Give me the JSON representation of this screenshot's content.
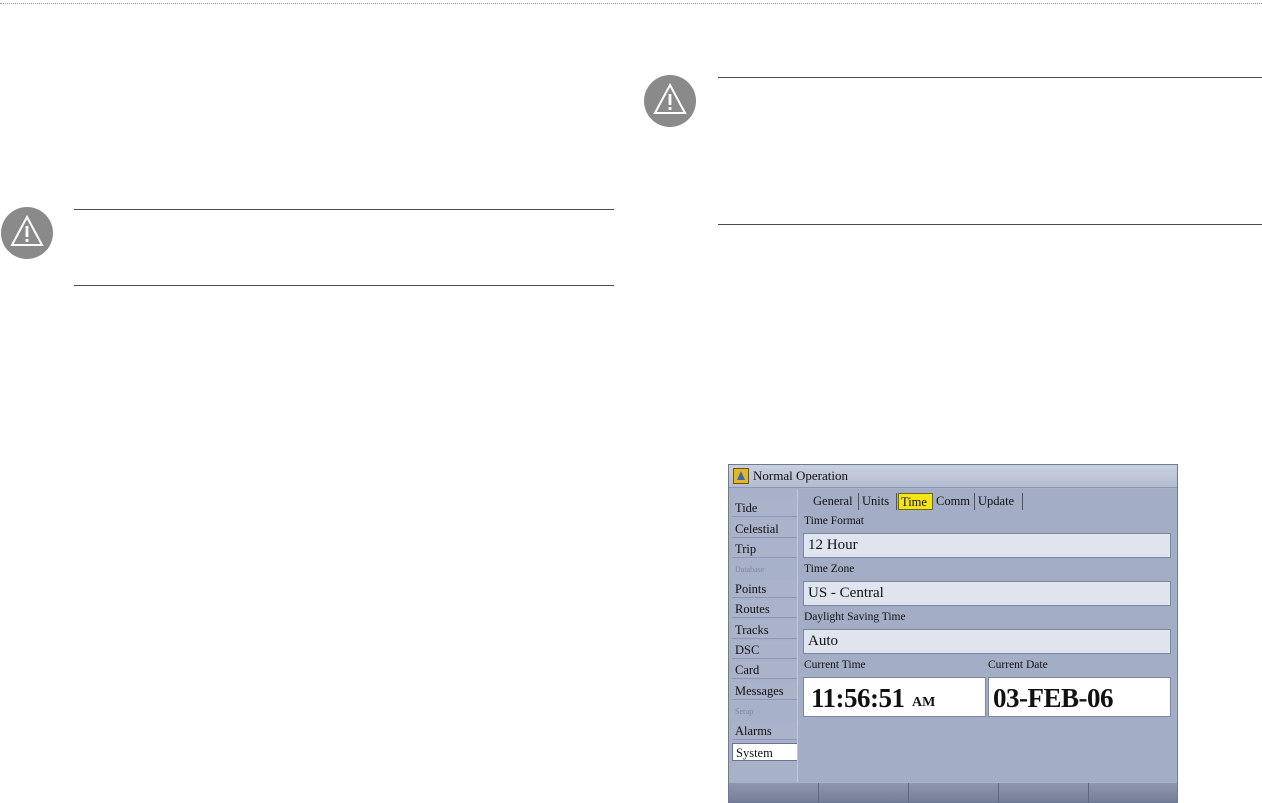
{
  "device": {
    "title": "Normal Operation",
    "sidebar_items": [
      {
        "label": "Tide",
        "type": "item"
      },
      {
        "label": "Celestial",
        "type": "item"
      },
      {
        "label": "Trip",
        "type": "item"
      },
      {
        "label": "Database",
        "type": "section"
      },
      {
        "label": "Points",
        "type": "item"
      },
      {
        "label": "Routes",
        "type": "item"
      },
      {
        "label": "Tracks",
        "type": "item"
      },
      {
        "label": "DSC",
        "type": "item"
      },
      {
        "label": "Card",
        "type": "item"
      },
      {
        "label": "Messages",
        "type": "item"
      },
      {
        "label": "Setup",
        "type": "section"
      },
      {
        "label": "Alarms",
        "type": "item"
      },
      {
        "label": "System",
        "type": "item",
        "selected": true
      }
    ],
    "tabs": [
      {
        "label": "General"
      },
      {
        "label": "Units"
      },
      {
        "label": "Time",
        "active": true
      },
      {
        "label": "Comm"
      },
      {
        "label": "Update"
      }
    ],
    "time_format": {
      "label": "Time Format",
      "value": "12 Hour"
    },
    "time_zone": {
      "label": "Time Zone",
      "value": "US - Central"
    },
    "daylight_saving": {
      "label": "Daylight Saving Time",
      "value": "Auto"
    },
    "current_time": {
      "label": "Current Time",
      "value": "11:56:51",
      "suffix": "AM"
    },
    "current_date": {
      "label": "Current Date",
      "value": "03-FEB-06"
    },
    "softkey_count": 5
  },
  "colors": {
    "screen_bg": "#a7b1c8",
    "active_tab": "#f6e414",
    "warning_icon": "#8a8a8a"
  },
  "icons": {
    "warning": "warning-triangle-icon",
    "title": "device-logo-icon"
  }
}
